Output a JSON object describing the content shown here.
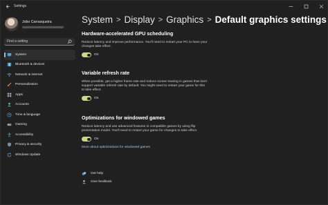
{
  "window": {
    "title": "Settings",
    "controls": [
      "minimize-icon",
      "maximize-icon",
      "close-icon"
    ]
  },
  "profile": {
    "name": "Jobo Carrasqueira"
  },
  "search": {
    "placeholder": "Find a setting"
  },
  "sidebar": {
    "items": [
      {
        "label": "System",
        "icon": "monitor-icon",
        "active": true
      },
      {
        "label": "Bluetooth & devices",
        "icon": "bluetooth-icon",
        "active": false
      },
      {
        "label": "Network & internet",
        "icon": "wifi-icon",
        "active": false
      },
      {
        "label": "Personalization",
        "icon": "brush-icon",
        "active": false
      },
      {
        "label": "Apps",
        "icon": "apps-icon",
        "active": false
      },
      {
        "label": "Accounts",
        "icon": "person-icon",
        "active": false
      },
      {
        "label": "Time & language",
        "icon": "globe-clock-icon",
        "active": false
      },
      {
        "label": "Gaming",
        "icon": "controller-icon",
        "active": false
      },
      {
        "label": "Accessibility",
        "icon": "accessibility-icon",
        "active": false
      },
      {
        "label": "Privacy & security",
        "icon": "shield-icon",
        "active": false
      },
      {
        "label": "Windows Update",
        "icon": "update-icon",
        "active": false
      }
    ]
  },
  "breadcrumb": {
    "items": [
      "System",
      "Display",
      "Graphics"
    ],
    "current": "Default graphics settings",
    "separator": ">"
  },
  "sections": {
    "gpu": {
      "title": "Hardware-accelerated GPU scheduling",
      "description": "Reduce latency and improve performance. You'll need to restart your PC to have your changes take effect.",
      "toggle_label": "On"
    },
    "vrr": {
      "title": "Variable refresh rate",
      "description": "When possible, get a higher frame rate and reduce screen tearing in games that don't support variable refresh rate by default. You might need to restart your game for this to take effect.",
      "toggle_label": "On"
    },
    "windowed": {
      "title": "Optimizations for windowed games",
      "description": "Reduce latency and use advanced features in compatible games by using flip presentation model. You'll need to restart your game for changes to take effect.",
      "toggle_label": "On",
      "link": "More about optimizations for windowed games"
    }
  },
  "help": {
    "get_help": "Get help",
    "feedback": "Give feedback"
  },
  "colors": {
    "background": "#202020",
    "accent": "#8ec4ee",
    "toggle_on": "#c9d98a",
    "link": "#a9cbe9"
  }
}
